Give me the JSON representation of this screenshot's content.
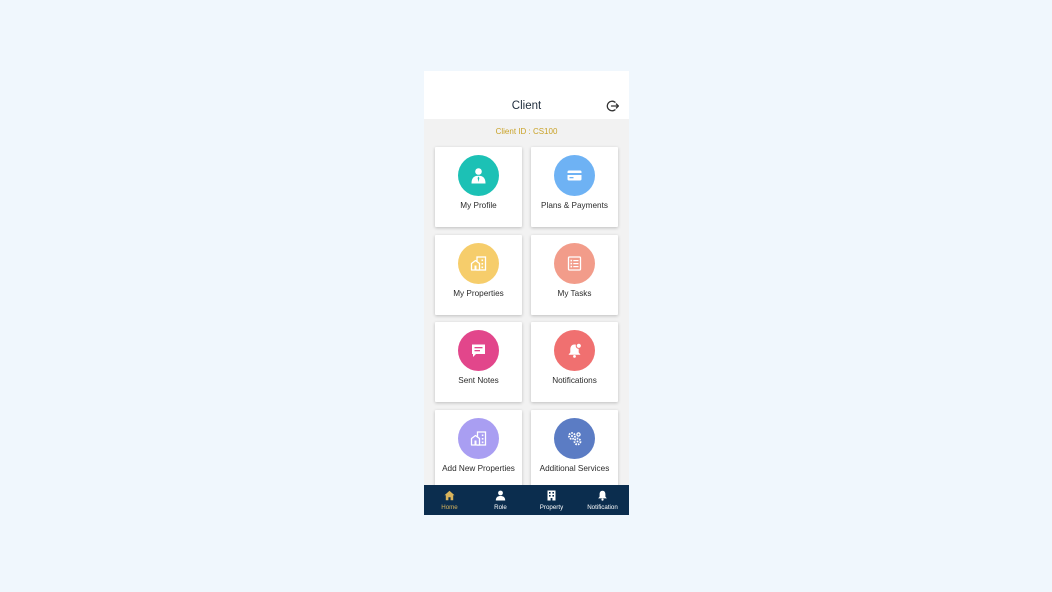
{
  "colors": {
    "background": "#f0f7fd",
    "accent": "#c9a227",
    "navbar": "#0b2d4e",
    "active_nav": "#d9b45c"
  },
  "header": {
    "title": "Client",
    "logout_icon": "logout-icon"
  },
  "client_id": "Client ID : CS100",
  "tiles": [
    {
      "label": "My Profile",
      "icon": "user-icon",
      "color": "#1cc1b5"
    },
    {
      "label": "Plans & Payments",
      "icon": "credit-card-icon",
      "color": "#6eb2f4"
    },
    {
      "label": "My Properties",
      "icon": "building-icon",
      "color": "#f6cd6b"
    },
    {
      "label": "My Tasks",
      "icon": "task-list-icon",
      "color": "#f29c8a"
    },
    {
      "label": "Sent Notes",
      "icon": "note-icon",
      "color": "#e2468b"
    },
    {
      "label": "Notifications",
      "icon": "bell-icon",
      "color": "#f07070"
    },
    {
      "label": "Add New Properties",
      "icon": "add-property-icon",
      "color": "#a99ef2"
    },
    {
      "label": "Additional Services",
      "icon": "gears-icon",
      "color": "#5b7cc4"
    }
  ],
  "nav": [
    {
      "label": "Home",
      "icon": "home-icon",
      "active": true
    },
    {
      "label": "Role",
      "icon": "person-icon",
      "active": false
    },
    {
      "label": "Property",
      "icon": "property-icon",
      "active": false
    },
    {
      "label": "Notification",
      "icon": "bell-icon",
      "active": false
    }
  ]
}
